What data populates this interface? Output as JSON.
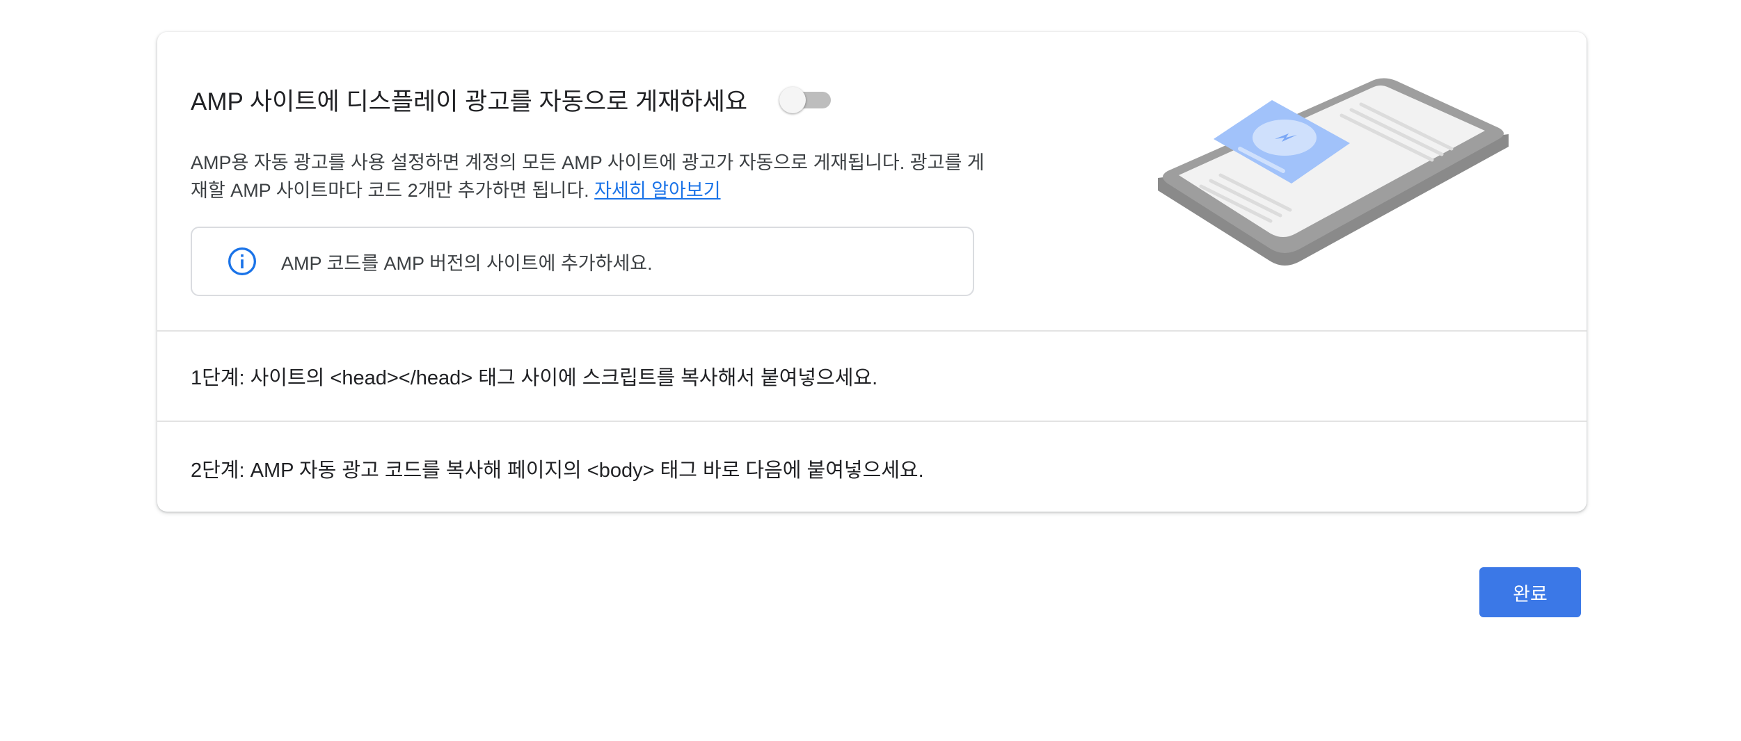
{
  "header": {
    "title": "AMP 사이트에 디스플레이 광고를 자동으로 게재하세요",
    "toggle_state": "off"
  },
  "description": {
    "text": "AMP용 자동 광고를 사용 설정하면 계정의 모든 AMP 사이트에 광고가 자동으로 게재됩니다. 광고를 게재할 AMP 사이트마다 코드 2개만 추가하면 됩니다. ",
    "link": "자세히 알아보기"
  },
  "info": {
    "icon": "info-icon",
    "text": "AMP 코드를 AMP 버전의 사이트에 추가하세요."
  },
  "illustration": {
    "icon": "phone-amp-illustration"
  },
  "steps": [
    {
      "label": "1단계: 사이트의 <head></head> 태그 사이에 스크립트를 복사해서 붙여넣으세요."
    },
    {
      "label": "2단계: AMP 자동 광고 코드를 복사해 페이지의 <body> 태그 바로 다음에 붙여넣으세요."
    }
  ],
  "footer": {
    "done_label": "완료"
  },
  "colors": {
    "accent": "#1a73e8",
    "button": "#3b78e7",
    "divider": "#e3e3e3"
  }
}
